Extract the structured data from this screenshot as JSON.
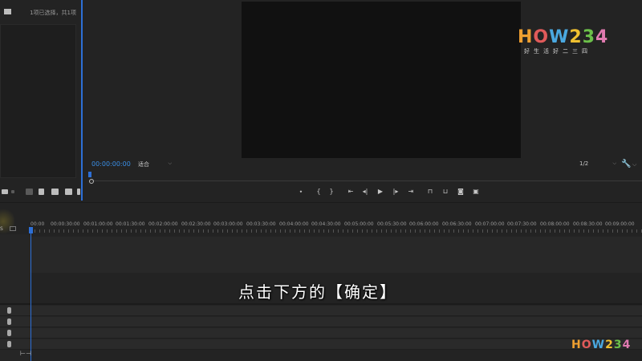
{
  "project_panel": {
    "selection_status": "1项已选择，共1项"
  },
  "monitor": {
    "timecode": "00:00:00:00",
    "zoom_value": "适合",
    "resolution_value": "1/2"
  },
  "transport": {
    "buttons": [
      "marker",
      "mark-in",
      "mark-out",
      "go-to-in",
      "step-back",
      "play",
      "step-forward",
      "go-to-out",
      "lift",
      "extract",
      "export-frame",
      "button-editor"
    ]
  },
  "timeline": {
    "ruler_labels": [
      "00:00",
      "00:00:30:00",
      "00:01:00:00",
      "00:01:30:00",
      "00:02:00:00",
      "00:02:30:00",
      "00:03:00:00",
      "00:03:30:00",
      "00:04:00:00",
      "00:04:30:00",
      "00:05:00:00",
      "00:05:30:00",
      "00:06:00:00",
      "00:06:30:00",
      "00:07:00:00",
      "00:07:30:00",
      "00:08:00:00",
      "00:08:30:00",
      "00:09:00:00"
    ],
    "track_label": "S"
  },
  "subtitle": "点击下方的【确定】",
  "watermark": {
    "logo_text": "HOW234",
    "tagline": "好生活好二三四"
  },
  "colors": {
    "accent_blue": "#2d6fd6",
    "timecode_blue": "#3a8ee6",
    "background": "#232323"
  }
}
